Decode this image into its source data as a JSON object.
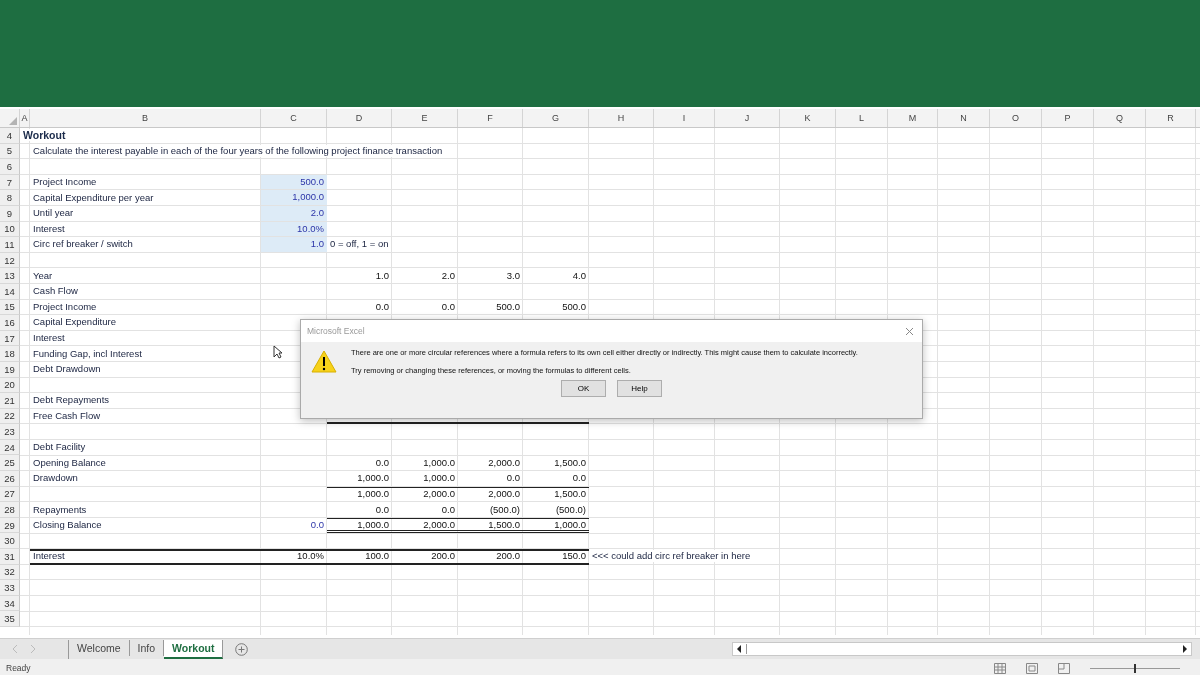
{
  "columns": [
    "A",
    "B",
    "C",
    "D",
    "E",
    "F",
    "G",
    "H",
    "I",
    "J",
    "K",
    "L",
    "M",
    "N",
    "O",
    "P",
    "Q",
    "R"
  ],
  "rows": [
    {
      "num": "4",
      "kind": "title",
      "A": "Workout"
    },
    {
      "num": "5",
      "kind": "plain",
      "B": "Calculate the interest payable in each of the four years of the following project finance transaction"
    },
    {
      "num": "6",
      "kind": "plain"
    },
    {
      "num": "7",
      "kind": "input",
      "B": "Project Income",
      "C": "500.0"
    },
    {
      "num": "8",
      "kind": "input",
      "B": "Capital Expenditure per year",
      "C": "1,000.0"
    },
    {
      "num": "9",
      "kind": "input",
      "B": "Until year",
      "C": "2.0"
    },
    {
      "num": "10",
      "kind": "input",
      "B": "Interest",
      "C": "10.0%"
    },
    {
      "num": "11",
      "kind": "input",
      "B": "Circ ref breaker / switch",
      "C": "1.0",
      "note": "0 = off, 1 = on"
    },
    {
      "num": "12",
      "kind": "plain"
    },
    {
      "num": "13",
      "kind": "plain",
      "B": "Year",
      "D": "1.0",
      "E": "2.0",
      "F": "3.0",
      "G": "4.0"
    },
    {
      "num": "14",
      "kind": "plain",
      "B": "Cash Flow"
    },
    {
      "num": "15",
      "kind": "plain",
      "B": "Project Income",
      "D": "0.0",
      "E": "0.0",
      "F": "500.0",
      "G": "500.0"
    },
    {
      "num": "16",
      "kind": "plain",
      "B": "Capital Expenditure"
    },
    {
      "num": "17",
      "kind": "plain",
      "B": "Interest"
    },
    {
      "num": "18",
      "kind": "plain",
      "B": "Funding Gap, incl Interest"
    },
    {
      "num": "19",
      "kind": "plain",
      "B": "Debt Drawdown"
    },
    {
      "num": "20",
      "kind": "plain"
    },
    {
      "num": "21",
      "kind": "plain",
      "B": "Debt Repayments"
    },
    {
      "num": "22",
      "kind": "underlined",
      "B": "Free Cash Flow"
    },
    {
      "num": "23",
      "kind": "plain"
    },
    {
      "num": "24",
      "kind": "plain",
      "B": "Debt Facility"
    },
    {
      "num": "25",
      "kind": "plain",
      "B": "Opening Balance",
      "D": "0.0",
      "E": "1,000.0",
      "F": "2,000.0",
      "G": "1,500.0"
    },
    {
      "num": "26",
      "kind": "plain",
      "B": "Drawdown",
      "D": "1,000.0",
      "E": "1,000.0",
      "F": "0.0",
      "G": "0.0"
    },
    {
      "num": "27",
      "kind": "subtotal",
      "D": "1,000.0",
      "E": "2,000.0",
      "F": "2,000.0",
      "G": "1,500.0"
    },
    {
      "num": "28",
      "kind": "plain",
      "B": "Repayments",
      "D": "0.0",
      "E": "0.0",
      "F": "(500.0)",
      "G": "(500.0)"
    },
    {
      "num": "29",
      "kind": "closing",
      "B": "Closing Balance",
      "C": "0.0",
      "D": "1,000.0",
      "E": "2,000.0",
      "F": "1,500.0",
      "G": "1,000.0"
    },
    {
      "num": "30",
      "kind": "plain"
    },
    {
      "num": "31",
      "kind": "total",
      "B": "Interest",
      "C": "10.0%",
      "D": "100.0",
      "E": "200.0",
      "F": "200.0",
      "G": "150.0",
      "note": "<<< could add circ ref breaker in here"
    },
    {
      "num": "32",
      "kind": "plain"
    },
    {
      "num": "33",
      "kind": "plain"
    },
    {
      "num": "34",
      "kind": "plain"
    },
    {
      "num": "35",
      "kind": "plain"
    }
  ],
  "dialog": {
    "title": "Microsoft Excel",
    "messages": [
      "There are one or more circular references where a formula refers to its own cell either directly or indirectly. This might cause them to calculate incorrectly.",
      "Try removing or changing these references, or moving the formulas to different cells."
    ],
    "buttons": [
      "OK",
      "Help"
    ]
  },
  "sheet_tabs": [
    {
      "label": "Welcome",
      "selected": false
    },
    {
      "label": "Info",
      "selected": false
    },
    {
      "label": "Workout",
      "selected": true
    }
  ],
  "status_bar": {
    "text": "Ready",
    "zoom": {
      "level": 0.5
    }
  }
}
